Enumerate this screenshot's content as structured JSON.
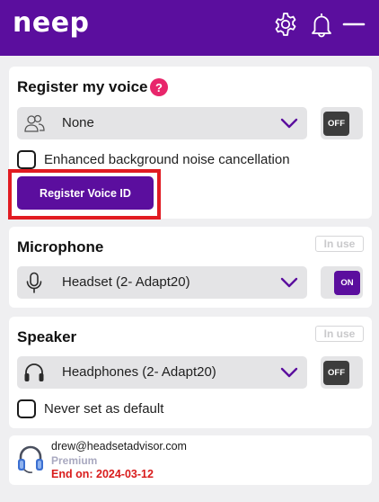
{
  "app": {
    "logo": "neep"
  },
  "colors": {
    "brand": "#5b0e9e",
    "help_badge": "#e8266b",
    "plan": "#a9a9c0",
    "end_date": "#d91c1c",
    "highlight": "#e11b22"
  },
  "header": {
    "icons": [
      "gear-icon",
      "bell-icon",
      "minimize-icon"
    ]
  },
  "voice": {
    "title": "Register my voice",
    "help": "?",
    "profile_select": "None",
    "toggle": "OFF",
    "noise_cancel_label": "Enhanced background noise cancellation",
    "noise_cancel_checked": false,
    "register_button": "Register Voice ID"
  },
  "microphone": {
    "title": "Microphone",
    "badge": "In use",
    "device": "Headset (2- Adapt20)",
    "toggle": "ON"
  },
  "speaker": {
    "title": "Speaker",
    "badge": "In use",
    "device": "Headphones (2- Adapt20)",
    "toggle": "OFF",
    "never_default_label": "Never set as default",
    "never_default_checked": false
  },
  "account": {
    "email": "drew@headsetadvisor.com",
    "plan": "Premium",
    "end_date": "End on: 2024-03-12"
  }
}
